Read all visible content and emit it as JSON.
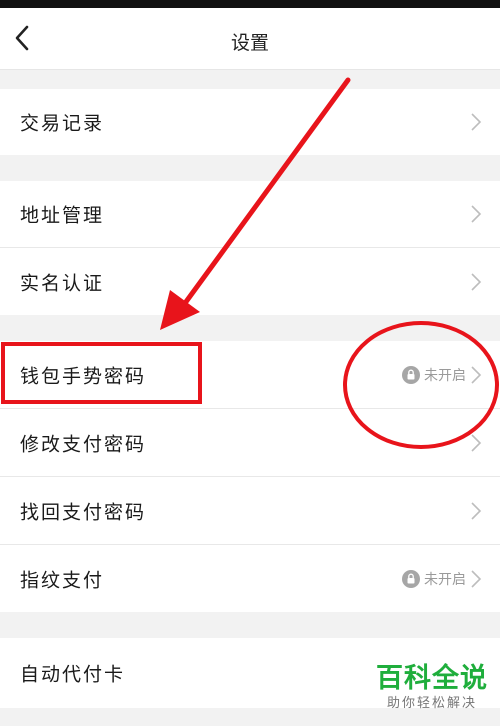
{
  "header": {
    "title": "设置"
  },
  "icons": {
    "back": "chevron-left-icon",
    "row_arrow": "chevron-right-icon",
    "lock": "lock-icon"
  },
  "colors": {
    "annotation_red": "#e8141b",
    "watermark_green": "#1fae3c",
    "status_gray": "#9a9a9a"
  },
  "settings": {
    "items": [
      {
        "label": "交易记录"
      },
      {
        "label": "地址管理"
      },
      {
        "label": "实名认证"
      },
      {
        "label": "钱包手势密码",
        "status": "未开启"
      },
      {
        "label": "修改支付密码"
      },
      {
        "label": "找回支付密码"
      },
      {
        "label": "指纹支付",
        "status": "未开启"
      },
      {
        "label": "自动代付卡"
      }
    ]
  },
  "watermark": {
    "title": "百科全说",
    "subtitle": "助你轻松解决"
  }
}
